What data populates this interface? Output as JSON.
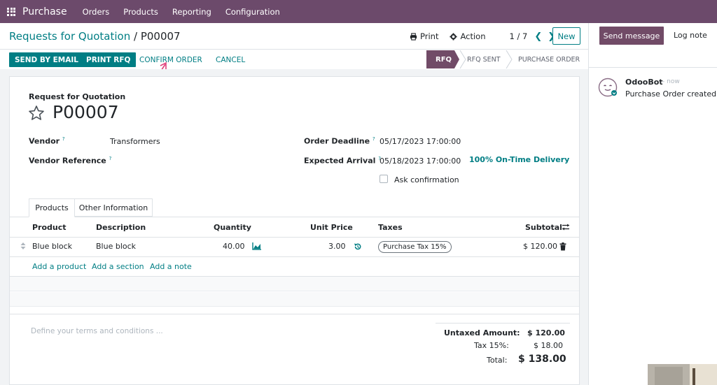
{
  "topnav": {
    "app_name": "Purchase",
    "items": [
      "Orders",
      "Products",
      "Reporting",
      "Configuration"
    ]
  },
  "control_panel": {
    "breadcrumb_parent": "Requests for Quotation",
    "breadcrumb_sep": "/",
    "breadcrumb_current": "P00007",
    "print_label": "Print",
    "action_label": "Action",
    "pager": "1 / 7",
    "new_label": "New"
  },
  "actions": {
    "send_email": "SEND BY EMAIL",
    "print_rfq": "PRINT RFQ",
    "confirm_order": "CONFIRM ORDER",
    "cancel": "CANCEL"
  },
  "statusbar": {
    "active": "RFQ",
    "steps": [
      "RFQ SENT",
      "PURCHASE ORDER"
    ]
  },
  "form": {
    "doc_type": "Request for Quotation",
    "name": "P00007",
    "vendor_label": "Vendor",
    "vendor_value": "Transformers",
    "vendor_ref_label": "Vendor Reference",
    "deadline_label": "Order Deadline",
    "deadline_value": "05/17/2023 17:00:00",
    "arrival_label": "Expected Arrival",
    "arrival_value": "05/18/2023 17:00:00",
    "on_time": "100% On-Time Delivery",
    "ask_confirmation": "Ask confirmation",
    "help_mark": "?"
  },
  "tabs": [
    "Products",
    "Other Information"
  ],
  "table": {
    "headers": {
      "product": "Product",
      "description": "Description",
      "quantity": "Quantity",
      "unit_price": "Unit Price",
      "taxes": "Taxes",
      "subtotal": "Subtotal"
    },
    "rows": [
      {
        "product": "Blue block",
        "description": "Blue block",
        "quantity": "40.00",
        "unit_price": "3.00",
        "tax": "Purchase Tax 15%",
        "subtotal": "$ 120.00"
      }
    ],
    "add_product": "Add a product",
    "add_section": "Add a section",
    "add_note": "Add a note"
  },
  "footer": {
    "terms_placeholder": "Define your terms and conditions ...",
    "untaxed_label": "Untaxed Amount:",
    "untaxed_value": "$ 120.00",
    "tax_label": "Tax 15%:",
    "tax_value": "$ 18.00",
    "total_label": "Total:",
    "total_value": "$ 138.00"
  },
  "chatter": {
    "send_message": "Send message",
    "log_note": "Log note",
    "message": {
      "author": "OdooBot",
      "time": "- now",
      "body": "Purchase Order created"
    }
  },
  "colors": {
    "brand": "#714b67",
    "nav": "#6c4a6b",
    "accent": "#017e84",
    "annotation": "#e0407b"
  }
}
